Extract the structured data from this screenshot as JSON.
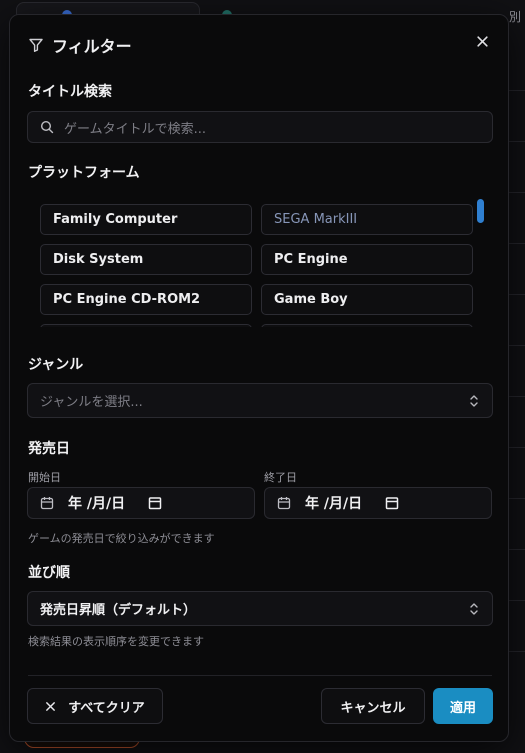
{
  "background": {
    "corner_text": "別"
  },
  "dialog": {
    "title": "フィルター",
    "title_search": {
      "label": "タイトル検索",
      "placeholder": "ゲームタイトルで検索..."
    },
    "platform": {
      "label": "プラットフォーム",
      "items": [
        {
          "label": "Family Computer"
        },
        {
          "label": "SEGA MarkIII"
        },
        {
          "label": "Disk System"
        },
        {
          "label": "PC Engine"
        },
        {
          "label": "PC Engine CD-ROM2"
        },
        {
          "label": "Game Boy"
        }
      ]
    },
    "genre": {
      "label": "ジャンル",
      "placeholder": "ジャンルを選択..."
    },
    "release_date": {
      "label": "発売日",
      "start_label": "開始日",
      "end_label": "終了日",
      "start_value": "年 /月/日",
      "end_value": "年 /月/日",
      "hint": "ゲームの発売日で絞り込みができます"
    },
    "sort": {
      "label": "並び順",
      "value": "発売日昇順（デフォルト）",
      "hint": "検索結果の表示順序を変更できます"
    },
    "buttons": {
      "clear": "すべてクリア",
      "cancel": "キャンセル",
      "apply": "適用"
    }
  },
  "colors": {
    "accent": "#1a8dc2",
    "scrollbar": "#2f7fd0"
  }
}
